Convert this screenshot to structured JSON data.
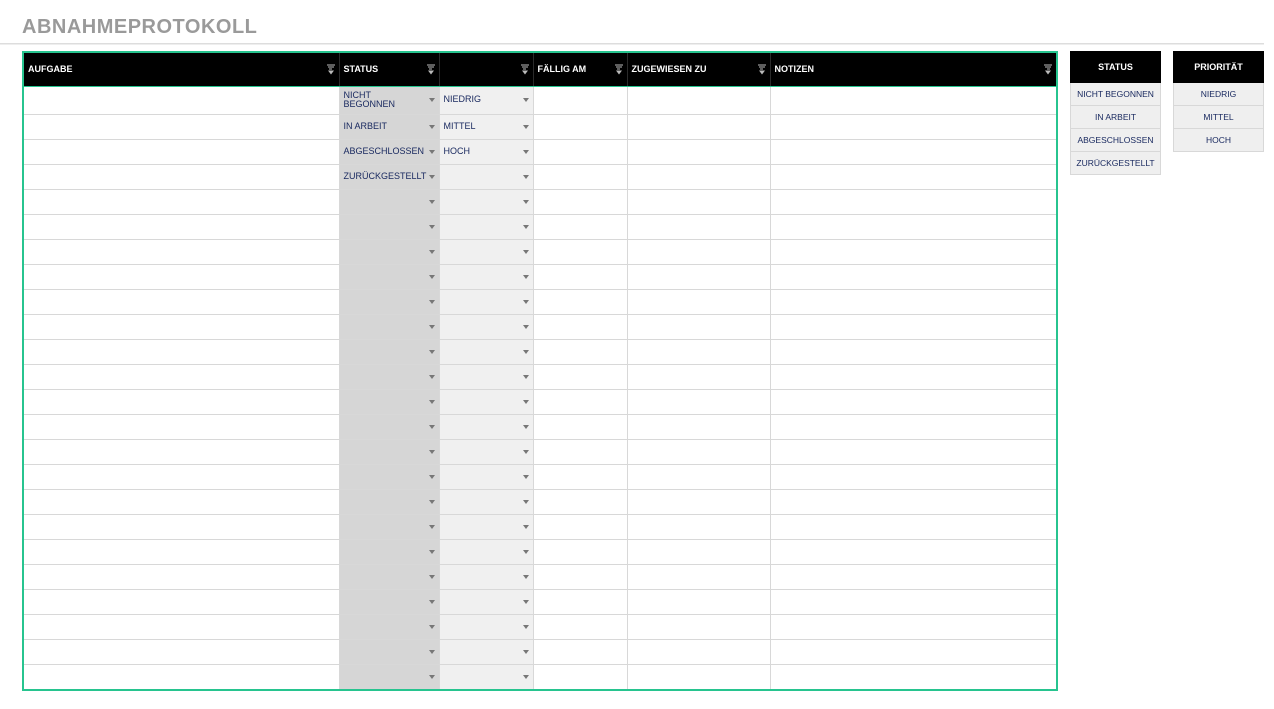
{
  "title": "ABNAHMEPROTOKOLL",
  "main": {
    "headers": [
      "AUFGABE",
      "STATUS",
      "",
      "FÄLLIG AM",
      "ZUGEWIESEN ZU",
      "NOTIZEN"
    ],
    "rows": [
      {
        "task": "",
        "status": "NICHT BEGONNEN",
        "prio": "NIEDRIG",
        "due": "",
        "assigned": "",
        "notes": ""
      },
      {
        "task": "",
        "status": "IN ARBEIT",
        "prio": "MITTEL",
        "due": "",
        "assigned": "",
        "notes": ""
      },
      {
        "task": "",
        "status": "ABGESCHLOSSEN",
        "prio": "HOCH",
        "due": "",
        "assigned": "",
        "notes": ""
      },
      {
        "task": "",
        "status": "ZURÜCKGESTELLT",
        "prio": "",
        "due": "",
        "assigned": "",
        "notes": ""
      },
      {
        "task": "",
        "status": "",
        "prio": "",
        "due": "",
        "assigned": "",
        "notes": ""
      },
      {
        "task": "",
        "status": "",
        "prio": "",
        "due": "",
        "assigned": "",
        "notes": ""
      },
      {
        "task": "",
        "status": "",
        "prio": "",
        "due": "",
        "assigned": "",
        "notes": ""
      },
      {
        "task": "",
        "status": "",
        "prio": "",
        "due": "",
        "assigned": "",
        "notes": ""
      },
      {
        "task": "",
        "status": "",
        "prio": "",
        "due": "",
        "assigned": "",
        "notes": ""
      },
      {
        "task": "",
        "status": "",
        "prio": "",
        "due": "",
        "assigned": "",
        "notes": ""
      },
      {
        "task": "",
        "status": "",
        "prio": "",
        "due": "",
        "assigned": "",
        "notes": ""
      },
      {
        "task": "",
        "status": "",
        "prio": "",
        "due": "",
        "assigned": "",
        "notes": ""
      },
      {
        "task": "",
        "status": "",
        "prio": "",
        "due": "",
        "assigned": "",
        "notes": ""
      },
      {
        "task": "",
        "status": "",
        "prio": "",
        "due": "",
        "assigned": "",
        "notes": ""
      },
      {
        "task": "",
        "status": "",
        "prio": "",
        "due": "",
        "assigned": "",
        "notes": ""
      },
      {
        "task": "",
        "status": "",
        "prio": "",
        "due": "",
        "assigned": "",
        "notes": ""
      },
      {
        "task": "",
        "status": "",
        "prio": "",
        "due": "",
        "assigned": "",
        "notes": ""
      },
      {
        "task": "",
        "status": "",
        "prio": "",
        "due": "",
        "assigned": "",
        "notes": ""
      },
      {
        "task": "",
        "status": "",
        "prio": "",
        "due": "",
        "assigned": "",
        "notes": ""
      },
      {
        "task": "",
        "status": "",
        "prio": "",
        "due": "",
        "assigned": "",
        "notes": ""
      },
      {
        "task": "",
        "status": "",
        "prio": "",
        "due": "",
        "assigned": "",
        "notes": ""
      },
      {
        "task": "",
        "status": "",
        "prio": "",
        "due": "",
        "assigned": "",
        "notes": ""
      },
      {
        "task": "",
        "status": "",
        "prio": "",
        "due": "",
        "assigned": "",
        "notes": ""
      },
      {
        "task": "",
        "status": "",
        "prio": "",
        "due": "",
        "assigned": "",
        "notes": ""
      }
    ]
  },
  "legend": {
    "status": {
      "header": "STATUS",
      "items": [
        "NICHT BEGONNEN",
        "IN ARBEIT",
        "ABGESCHLOSSEN",
        "ZURÜCKGESTELLT"
      ]
    },
    "prio": {
      "header": "PRIORITÄT",
      "items": [
        "NIEDRIG",
        "MITTEL",
        "HOCH"
      ]
    }
  }
}
